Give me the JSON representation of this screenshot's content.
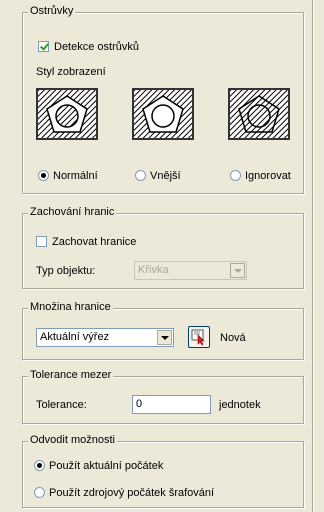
{
  "islands": {
    "legend": "Ostrůvky",
    "detect_label": "Detekce ostrůvků",
    "detect_checked": true,
    "style_label": "Styl zobrazení",
    "styles": [
      {
        "label": "Normální",
        "selected": true,
        "icon": "island-normal-icon"
      },
      {
        "label": "Vnější",
        "selected": false,
        "icon": "island-outer-icon"
      },
      {
        "label": "Ignorovat",
        "selected": false,
        "icon": "island-ignore-icon"
      }
    ]
  },
  "boundary_retention": {
    "legend": "Zachování hranic",
    "retain_label": "Zachovat hranice",
    "retain_checked": false,
    "object_type_label": "Typ objektu:",
    "object_type_value": "Křivka"
  },
  "boundary_set": {
    "legend": "Množina hranice",
    "value": "Aktuální výřez",
    "new_label": "Nová",
    "new_icon": "select-objects-icon"
  },
  "gap_tolerance": {
    "legend": "Tolerance mezer",
    "tolerance_label": "Tolerance:",
    "tolerance_value": "0",
    "units_label": "jednotek"
  },
  "inherit_options": {
    "legend": "Odvodit možnosti",
    "options": [
      {
        "label": "Použít aktuální počátek",
        "selected": true
      },
      {
        "label": "Použít zdrojový počátek šrafování",
        "selected": false
      }
    ]
  },
  "colors": {
    "background": "#ece9d8",
    "frame": "#aca899",
    "input_border": "#7f9db9"
  }
}
